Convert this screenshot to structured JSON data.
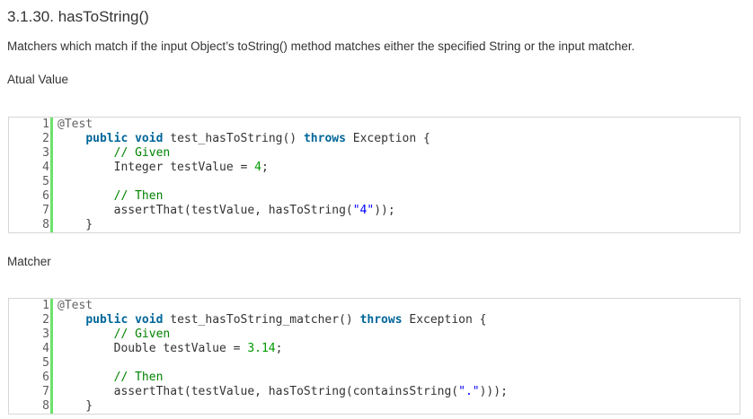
{
  "heading": "3.1.30. hasToString()",
  "description": "Matchers which match if the input Object’s toString() method matches either the specified String or the input matcher.",
  "sections": [
    {
      "label": "Atual Value",
      "lines": [
        {
          "n": "1",
          "tokens": [
            {
              "t": "@Test",
              "c": "ann"
            }
          ]
        },
        {
          "n": "2",
          "tokens": [
            {
              "t": "    ",
              "c": ""
            },
            {
              "t": "public",
              "c": "kw"
            },
            {
              "t": " ",
              "c": ""
            },
            {
              "t": "void",
              "c": "kw"
            },
            {
              "t": " test_hasToString() ",
              "c": ""
            },
            {
              "t": "throws",
              "c": "kw"
            },
            {
              "t": " Exception {",
              "c": ""
            }
          ]
        },
        {
          "n": "3",
          "tokens": [
            {
              "t": "        ",
              "c": ""
            },
            {
              "t": "// Given",
              "c": "cm"
            }
          ]
        },
        {
          "n": "4",
          "tokens": [
            {
              "t": "        Integer testValue = ",
              "c": ""
            },
            {
              "t": "4",
              "c": "num"
            },
            {
              "t": ";",
              "c": ""
            }
          ]
        },
        {
          "n": "5",
          "tokens": [
            {
              "t": " ",
              "c": ""
            }
          ]
        },
        {
          "n": "6",
          "tokens": [
            {
              "t": "        ",
              "c": ""
            },
            {
              "t": "// Then",
              "c": "cm"
            }
          ]
        },
        {
          "n": "7",
          "tokens": [
            {
              "t": "        assertThat(testValue, hasToString(",
              "c": ""
            },
            {
              "t": "\"4\"",
              "c": "str"
            },
            {
              "t": "));",
              "c": ""
            }
          ]
        },
        {
          "n": "8",
          "tokens": [
            {
              "t": "    }",
              "c": ""
            }
          ]
        }
      ]
    },
    {
      "label": "Matcher",
      "lines": [
        {
          "n": "1",
          "tokens": [
            {
              "t": "@Test",
              "c": "ann"
            }
          ]
        },
        {
          "n": "2",
          "tokens": [
            {
              "t": "    ",
              "c": ""
            },
            {
              "t": "public",
              "c": "kw"
            },
            {
              "t": " ",
              "c": ""
            },
            {
              "t": "void",
              "c": "kw"
            },
            {
              "t": " test_hasToString_matcher() ",
              "c": ""
            },
            {
              "t": "throws",
              "c": "kw"
            },
            {
              "t": " Exception {",
              "c": ""
            }
          ]
        },
        {
          "n": "3",
          "tokens": [
            {
              "t": "        ",
              "c": ""
            },
            {
              "t": "// Given",
              "c": "cm"
            }
          ]
        },
        {
          "n": "4",
          "tokens": [
            {
              "t": "        Double testValue = ",
              "c": ""
            },
            {
              "t": "3.14",
              "c": "num"
            },
            {
              "t": ";",
              "c": ""
            }
          ]
        },
        {
          "n": "5",
          "tokens": [
            {
              "t": " ",
              "c": ""
            }
          ]
        },
        {
          "n": "6",
          "tokens": [
            {
              "t": "        ",
              "c": ""
            },
            {
              "t": "// Then",
              "c": "cm"
            }
          ]
        },
        {
          "n": "7",
          "tokens": [
            {
              "t": "        assertThat(testValue, hasToString(containsString(",
              "c": ""
            },
            {
              "t": "\".\"",
              "c": "str"
            },
            {
              "t": ")));",
              "c": ""
            }
          ]
        },
        {
          "n": "8",
          "tokens": [
            {
              "t": "    }",
              "c": ""
            }
          ]
        }
      ]
    }
  ]
}
